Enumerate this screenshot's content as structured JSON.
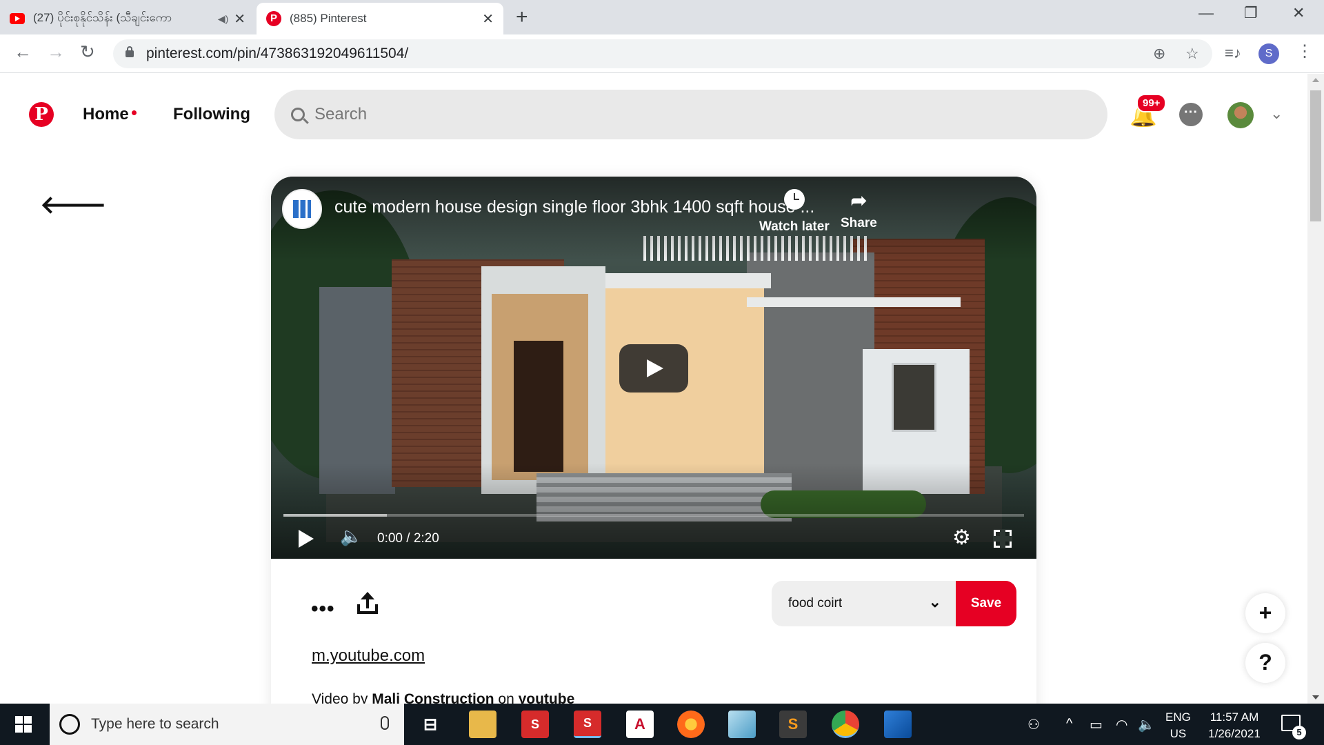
{
  "browser": {
    "tabs": [
      {
        "title": "(27) ပိုင်းစုနိုင်သိန်း (သီချင်းကော",
        "active": false,
        "favicon": "youtube-icon",
        "audio": true
      },
      {
        "title": "(885) Pinterest",
        "active": true,
        "favicon": "pinterest-icon"
      }
    ],
    "url": "pinterest.com/pin/473863192049611504/",
    "profile_initial": "S"
  },
  "header": {
    "nav": {
      "home": "Home",
      "following": "Following"
    },
    "search_placeholder": "Search",
    "notification_badge": "99+"
  },
  "pin": {
    "video": {
      "title": "cute modern house design single floor 3bhk 1400 sqft house ...",
      "watch_later": "Watch later",
      "share": "Share",
      "time": "0:00 / 2:20",
      "buffered_fraction": 0.14
    },
    "board": "food coirt",
    "save_label": "Save",
    "source_link": "m.youtube.com",
    "video_by_prefix": "Video by",
    "channel": "Mali Construction",
    "on_word": "on",
    "platform": "youtube"
  },
  "fab": {
    "plus": "+",
    "help": "?"
  },
  "taskbar": {
    "search_placeholder": "Type here to search",
    "lang_top": "ENG",
    "lang_bottom": "US",
    "time": "11:57 AM",
    "date": "1/26/2021",
    "notifications": "5"
  },
  "colors": {
    "pinterest_red": "#e60023",
    "taskbar": "#101820"
  }
}
